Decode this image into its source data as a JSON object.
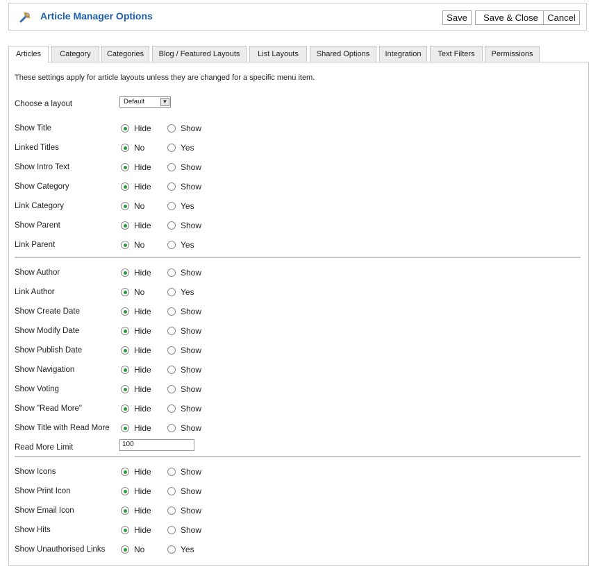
{
  "header": {
    "title": "Article Manager Options",
    "icon": "tools-icon",
    "buttons": {
      "save": "Save",
      "save_close": "Save & Close",
      "cancel": "Cancel"
    }
  },
  "tabs": [
    "Articles",
    "Category",
    "Categories",
    "Blog / Featured Layouts",
    "List Layouts",
    "Shared Options",
    "Integration",
    "Text Filters",
    "Permissions"
  ],
  "active_tab": "Articles",
  "intro": "These settings apply for article layouts unless they are changed for a specific menu item.",
  "layout": {
    "label": "Choose a layout",
    "value": "Default"
  },
  "options": [
    {
      "label": "Show Title",
      "a": "Hide",
      "b": "Show",
      "selected": "a"
    },
    {
      "label": "Linked Titles",
      "a": "No",
      "b": "Yes",
      "selected": "a"
    },
    {
      "label": "Show Intro Text",
      "a": "Hide",
      "b": "Show",
      "selected": "a"
    },
    {
      "label": "Show Category",
      "a": "Hide",
      "b": "Show",
      "selected": "a"
    },
    {
      "label": "Link Category",
      "a": "No",
      "b": "Yes",
      "selected": "a"
    },
    {
      "label": "Show Parent",
      "a": "Hide",
      "b": "Show",
      "selected": "a"
    },
    {
      "label": "Link Parent",
      "a": "No",
      "b": "Yes",
      "selected": "a"
    },
    {
      "label": "Show Author",
      "a": "Hide",
      "b": "Show",
      "selected": "a"
    },
    {
      "label": "Link Author",
      "a": "No",
      "b": "Yes",
      "selected": "a"
    },
    {
      "label": "Show Create Date",
      "a": "Hide",
      "b": "Show",
      "selected": "a"
    },
    {
      "label": "Show Modify Date",
      "a": "Hide",
      "b": "Show",
      "selected": "a"
    },
    {
      "label": "Show Publish Date",
      "a": "Hide",
      "b": "Show",
      "selected": "a"
    },
    {
      "label": "Show Navigation",
      "a": "Hide",
      "b": "Show",
      "selected": "a"
    },
    {
      "label": "Show Voting",
      "a": "Hide",
      "b": "Show",
      "selected": "a"
    },
    {
      "label": "Show \"Read More\"",
      "a": "Hide",
      "b": "Show",
      "selected": "a"
    },
    {
      "label": "Show Title with Read More",
      "a": "Hide",
      "b": "Show",
      "selected": "a"
    },
    {
      "label": "Show Icons",
      "a": "Hide",
      "b": "Show",
      "selected": "a"
    },
    {
      "label": "Show Print Icon",
      "a": "Hide",
      "b": "Show",
      "selected": "a"
    },
    {
      "label": "Show Email Icon",
      "a": "Hide",
      "b": "Show",
      "selected": "a"
    },
    {
      "label": "Show Hits",
      "a": "Hide",
      "b": "Show",
      "selected": "a"
    },
    {
      "label": "Show Unauthorised Links",
      "a": "No",
      "b": "Yes",
      "selected": "a"
    }
  ],
  "read_more_limit": {
    "label": "Read More Limit",
    "value": "100"
  },
  "colors": {
    "title": "#1e5ea8",
    "radio_selected": "#2c9a3a",
    "border": "#c8c8c8"
  }
}
